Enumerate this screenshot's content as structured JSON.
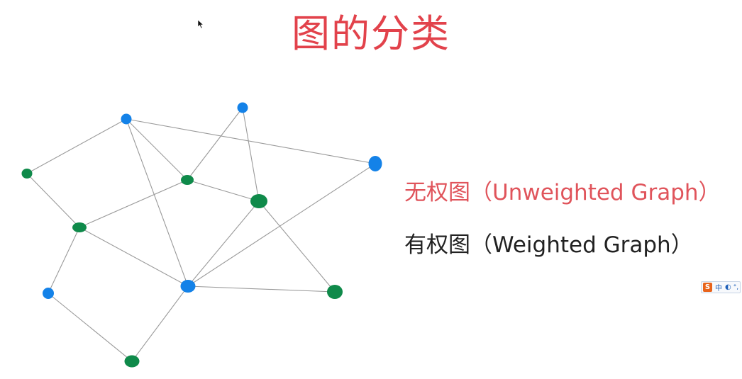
{
  "title": "图的分类",
  "labels": {
    "unweighted": "无权图（Unweighted Graph）",
    "weighted": "有权图（Weighted Graph）"
  },
  "colors": {
    "title": "#e2424b",
    "unweighted_label": "#e0545b",
    "weighted_label": "#222222",
    "node_blue": "#1482e8",
    "node_green": "#0f8a4a",
    "edge": "#9a9a9a"
  },
  "ime_toolbar": {
    "logo": "S",
    "language": "中",
    "icons": [
      "moon-icon",
      "punctuation-icon"
    ]
  },
  "graph": {
    "nodes": [
      {
        "id": "n1",
        "color": "blue"
      },
      {
        "id": "n2",
        "color": "blue"
      },
      {
        "id": "n3",
        "color": "green"
      },
      {
        "id": "n4",
        "color": "blue"
      },
      {
        "id": "n5",
        "color": "green"
      },
      {
        "id": "n6",
        "color": "green"
      },
      {
        "id": "n7",
        "color": "green"
      },
      {
        "id": "n8",
        "color": "blue"
      },
      {
        "id": "n9",
        "color": "blue"
      },
      {
        "id": "n10",
        "color": "green"
      },
      {
        "id": "n11",
        "color": "green"
      }
    ],
    "edges": [
      [
        "n1",
        "n3"
      ],
      [
        "n1",
        "n5"
      ],
      [
        "n1",
        "n4"
      ],
      [
        "n1",
        "n9"
      ],
      [
        "n2",
        "n5"
      ],
      [
        "n2",
        "n6"
      ],
      [
        "n3",
        "n7"
      ],
      [
        "n5",
        "n7"
      ],
      [
        "n5",
        "n6"
      ],
      [
        "n7",
        "n8"
      ],
      [
        "n7",
        "n9"
      ],
      [
        "n6",
        "n9"
      ],
      [
        "n6",
        "n10"
      ],
      [
        "n4",
        "n9"
      ],
      [
        "n8",
        "n11"
      ],
      [
        "n9",
        "n10"
      ],
      [
        "n9",
        "n11"
      ]
    ]
  }
}
